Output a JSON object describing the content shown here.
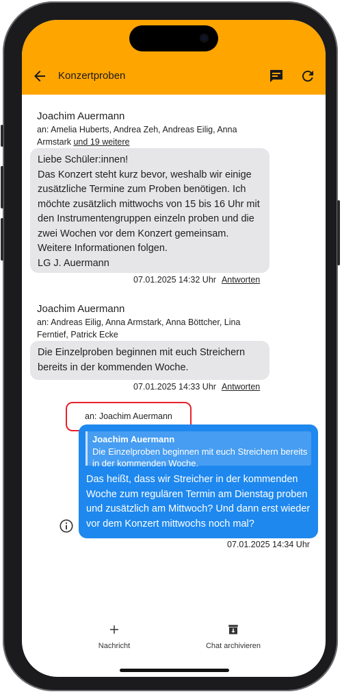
{
  "header": {
    "title": "Konzertproben"
  },
  "messages": [
    {
      "sender": "Joachim Auermann",
      "recipients": "an: Amelia Huberts, Andrea Zeh, Andreas Eilig, Anna Armstark",
      "recipients_more": "und 19 weitere",
      "lines": [
        "Liebe Schüler:innen!",
        "Das Konzert steht kurz bevor, weshalb wir einige",
        "zusätzliche Termine zum Proben benötigen. Ich",
        "möchte zusätzlich mittwochs von 15 bis 16 Uhr mit",
        "den Instrumentengruppen einzeln proben und die",
        "zwei Wochen vor dem Konzert gemeinsam.",
        "Weitere Informationen folgen.",
        "LG J. Auermann"
      ],
      "timestamp": "07.01.2025 14:32 Uhr",
      "reply_label": "Antworten"
    },
    {
      "sender": "Joachim Auermann",
      "recipients_line1": "an: Andreas Eilig, Anna Armstark, Anna Böttcher, Lina",
      "recipients_line2": "Ferntief, Patrick Ecke",
      "lines": [
        "Die Einzelproben beginnen mit euch Streichern",
        "bereits in der kommenden Woche."
      ],
      "timestamp": "07.01.2025 14:33 Uhr",
      "reply_label": "Antworten"
    }
  ],
  "own_message": {
    "to": "an: Joachim Auermann",
    "quote_name": "Joachim Auermann",
    "quote_text": "Die Einzelproben beginnen mit euch Streichern bereits in der kommenden Woche.",
    "lines": [
      "Das heißt, dass wir Streicher in der kommenden",
      "Woche zum regulären Termin am Dienstag proben",
      "und zusätzlich am Mittwoch? Und dann erst wieder",
      "vor dem Konzert mittwochs noch mal?"
    ],
    "timestamp": "07.01.2025 14:34 Uhr"
  },
  "bottom_bar": {
    "new_message": "Nachricht",
    "archive": "Chat archivieren"
  },
  "colors": {
    "app_bar": "#ffa500",
    "incoming_bubble": "#e6e6e9",
    "outgoing_bubble": "#1e88ee",
    "highlight": "#e8202a"
  }
}
